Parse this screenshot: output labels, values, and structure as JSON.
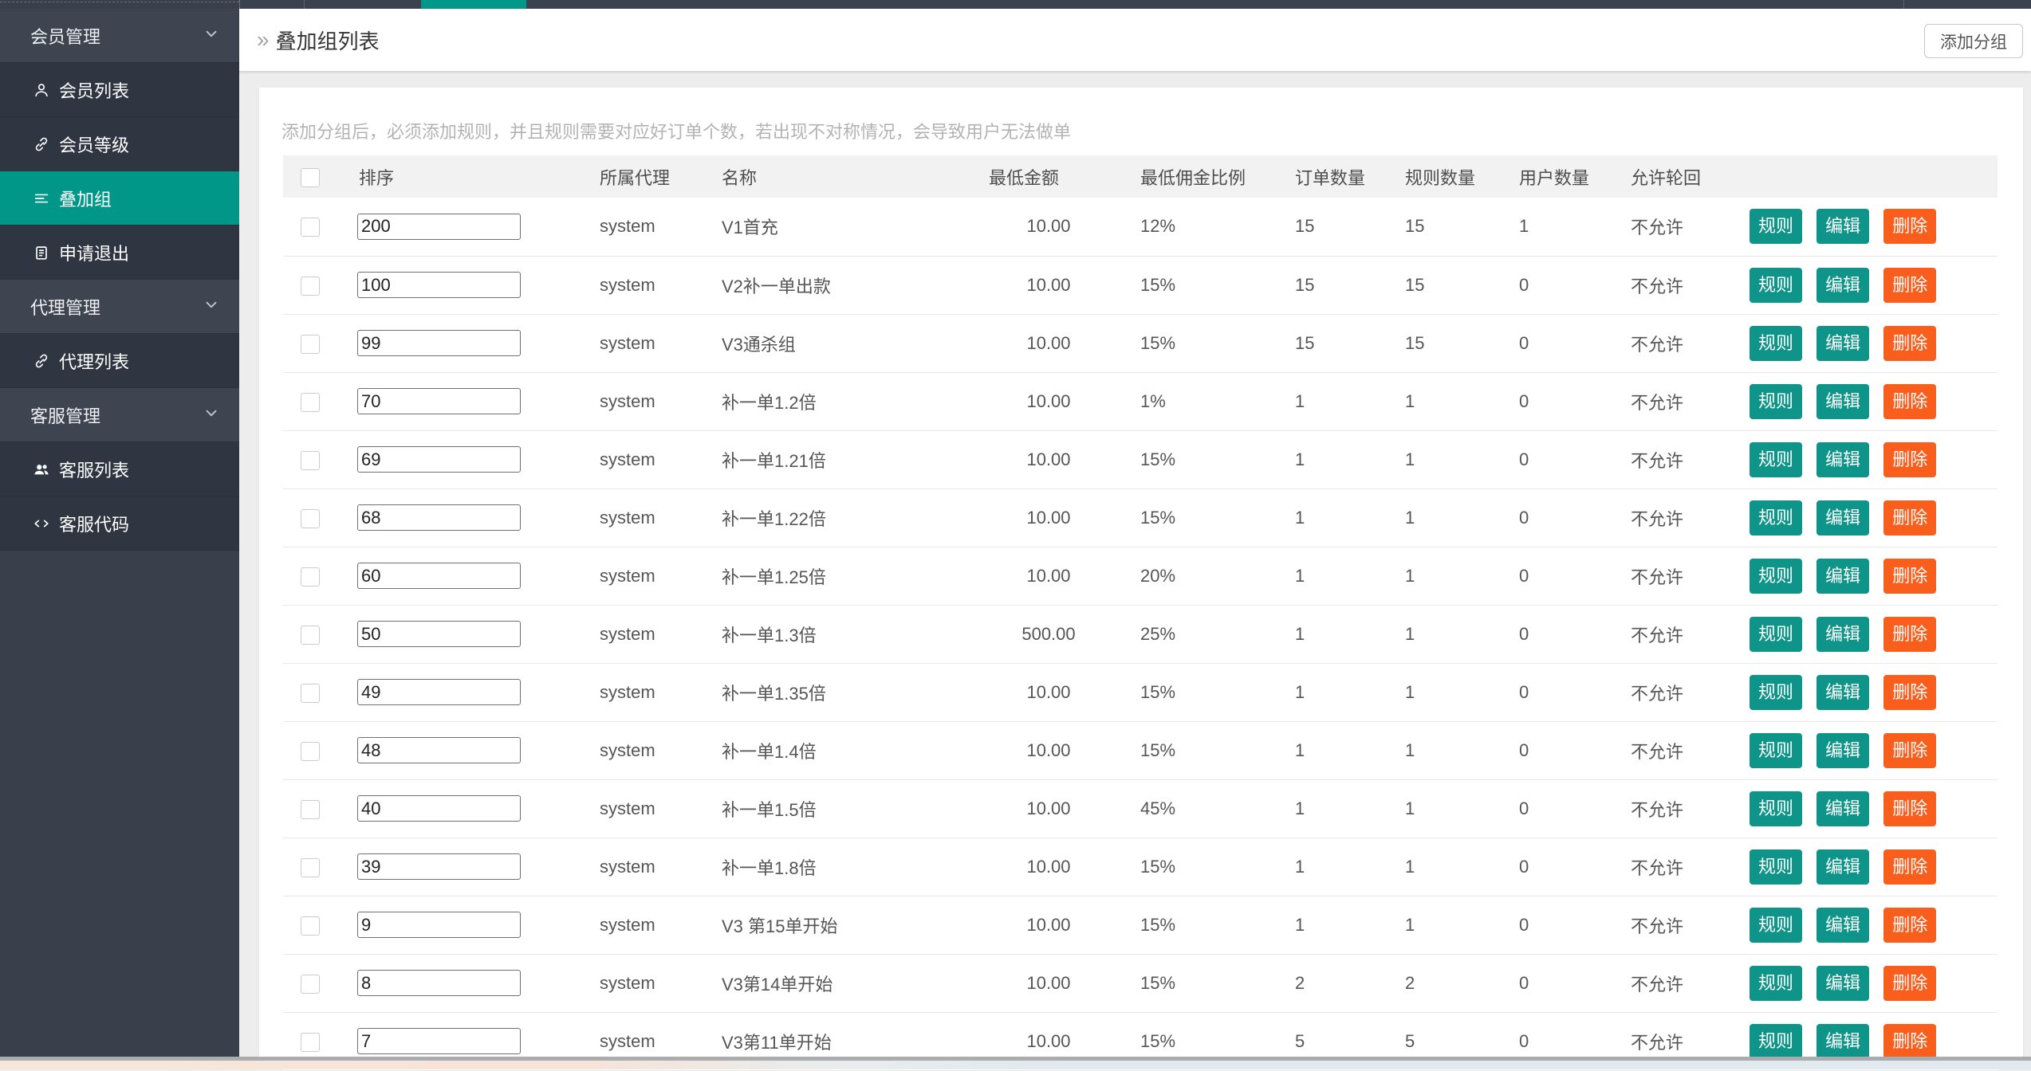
{
  "sidebar": {
    "items": [
      {
        "label": "会员管理",
        "type": "parent",
        "icon": "chevron-down-icon"
      },
      {
        "label": "会员列表",
        "type": "child",
        "icon": "user-icon"
      },
      {
        "label": "会员等级",
        "type": "child",
        "icon": "link-icon"
      },
      {
        "label": "叠加组",
        "type": "child",
        "icon": "list-icon",
        "active": true
      },
      {
        "label": "申请退出",
        "type": "child",
        "icon": "clipboard-icon"
      },
      {
        "label": "代理管理",
        "type": "parent",
        "icon": "chevron-down-icon"
      },
      {
        "label": "代理列表",
        "type": "child",
        "icon": "link-icon"
      },
      {
        "label": "客服管理",
        "type": "parent",
        "icon": "chevron-down-icon"
      },
      {
        "label": "客服列表",
        "type": "child",
        "icon": "users-icon"
      },
      {
        "label": "客服代码",
        "type": "child",
        "icon": "code-icon"
      }
    ]
  },
  "header": {
    "title": "叠加组列表",
    "breadcrumb_caret": "»",
    "add_button_label": "添加分组"
  },
  "notice": "添加分组后，必须添加规则，并且规则需要对应好订单个数，若出现不对称情况，会导致用户无法做单",
  "table": {
    "columns": [
      "排序",
      "所属代理",
      "名称",
      "最低金额",
      "最低佣金比例",
      "订单数量",
      "规则数量",
      "用户数量",
      "允许轮回"
    ],
    "actions": [
      "规则",
      "编辑",
      "删除"
    ],
    "rows": [
      {
        "sort": "200",
        "agent": "system",
        "name": "V1首充",
        "min_amount": "10.00",
        "min_commission": "12%",
        "orders": "15",
        "rules": "15",
        "users": "1",
        "cycle": "不允许"
      },
      {
        "sort": "100",
        "agent": "system",
        "name": "V2补一单出款",
        "min_amount": "10.00",
        "min_commission": "15%",
        "orders": "15",
        "rules": "15",
        "users": "0",
        "cycle": "不允许"
      },
      {
        "sort": "99",
        "agent": "system",
        "name": "V3通杀组",
        "min_amount": "10.00",
        "min_commission": "15%",
        "orders": "15",
        "rules": "15",
        "users": "0",
        "cycle": "不允许"
      },
      {
        "sort": "70",
        "agent": "system",
        "name": "补一单1.2倍",
        "min_amount": "10.00",
        "min_commission": "1%",
        "orders": "1",
        "rules": "1",
        "users": "0",
        "cycle": "不允许"
      },
      {
        "sort": "69",
        "agent": "system",
        "name": "补一单1.21倍",
        "min_amount": "10.00",
        "min_commission": "15%",
        "orders": "1",
        "rules": "1",
        "users": "0",
        "cycle": "不允许"
      },
      {
        "sort": "68",
        "agent": "system",
        "name": "补一单1.22倍",
        "min_amount": "10.00",
        "min_commission": "15%",
        "orders": "1",
        "rules": "1",
        "users": "0",
        "cycle": "不允许"
      },
      {
        "sort": "60",
        "agent": "system",
        "name": "补一单1.25倍",
        "min_amount": "10.00",
        "min_commission": "20%",
        "orders": "1",
        "rules": "1",
        "users": "0",
        "cycle": "不允许"
      },
      {
        "sort": "50",
        "agent": "system",
        "name": "补一单1.3倍",
        "min_amount": "500.00",
        "min_commission": "25%",
        "orders": "1",
        "rules": "1",
        "users": "0",
        "cycle": "不允许"
      },
      {
        "sort": "49",
        "agent": "system",
        "name": "补一单1.35倍",
        "min_amount": "10.00",
        "min_commission": "15%",
        "orders": "1",
        "rules": "1",
        "users": "0",
        "cycle": "不允许"
      },
      {
        "sort": "48",
        "agent": "system",
        "name": "补一单1.4倍",
        "min_amount": "10.00",
        "min_commission": "15%",
        "orders": "1",
        "rules": "1",
        "users": "0",
        "cycle": "不允许"
      },
      {
        "sort": "40",
        "agent": "system",
        "name": "补一单1.5倍",
        "min_amount": "10.00",
        "min_commission": "45%",
        "orders": "1",
        "rules": "1",
        "users": "0",
        "cycle": "不允许"
      },
      {
        "sort": "39",
        "agent": "system",
        "name": "补一单1.8倍",
        "min_amount": "10.00",
        "min_commission": "15%",
        "orders": "1",
        "rules": "1",
        "users": "0",
        "cycle": "不允许"
      },
      {
        "sort": "9",
        "agent": "system",
        "name": "V3 第15单开始",
        "min_amount": "10.00",
        "min_commission": "15%",
        "orders": "1",
        "rules": "1",
        "users": "0",
        "cycle": "不允许"
      },
      {
        "sort": "8",
        "agent": "system",
        "name": "V3第14单开始",
        "min_amount": "10.00",
        "min_commission": "15%",
        "orders": "2",
        "rules": "2",
        "users": "0",
        "cycle": "不允许"
      },
      {
        "sort": "7",
        "agent": "system",
        "name": "V3第11单开始",
        "min_amount": "10.00",
        "min_commission": "15%",
        "orders": "5",
        "rules": "5",
        "users": "0",
        "cycle": "不允许"
      }
    ]
  },
  "colors": {
    "accent": "#009688",
    "button_teal": "#0e9488",
    "button_orange": "#f95e1d",
    "sidebar_bg": "#393f4b",
    "sidebar_child_bg": "#2f3541",
    "table_header_bg": "#f2f2f2",
    "notice_text": "#b3b3b3"
  }
}
